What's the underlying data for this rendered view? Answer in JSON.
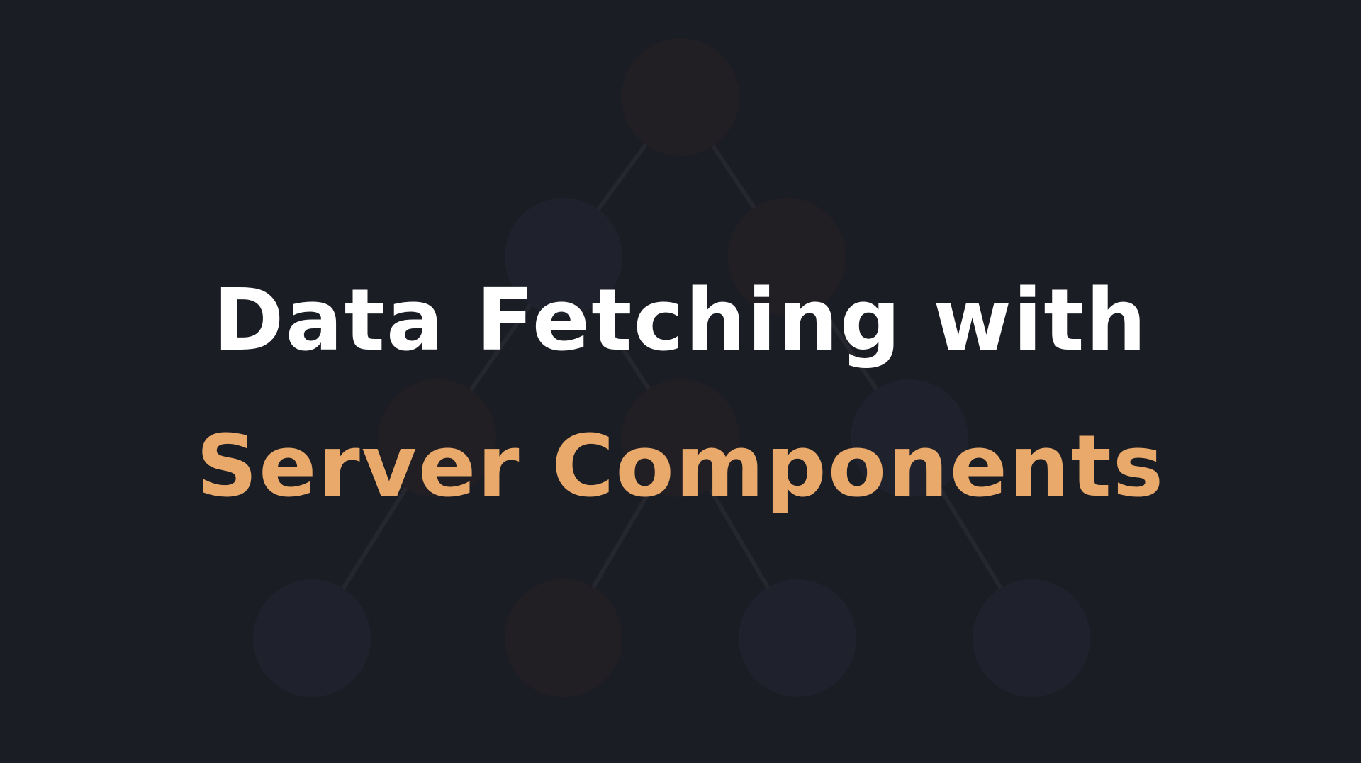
{
  "title": {
    "line1": "Data Fetching with",
    "line2": "Server Components"
  },
  "colors": {
    "background": "#1b1d25",
    "title_primary": "#ffffff",
    "title_accent": "#e8a96a",
    "node_warm": "#221f24",
    "node_cool": "#1f212c",
    "connector": "#26272e"
  }
}
